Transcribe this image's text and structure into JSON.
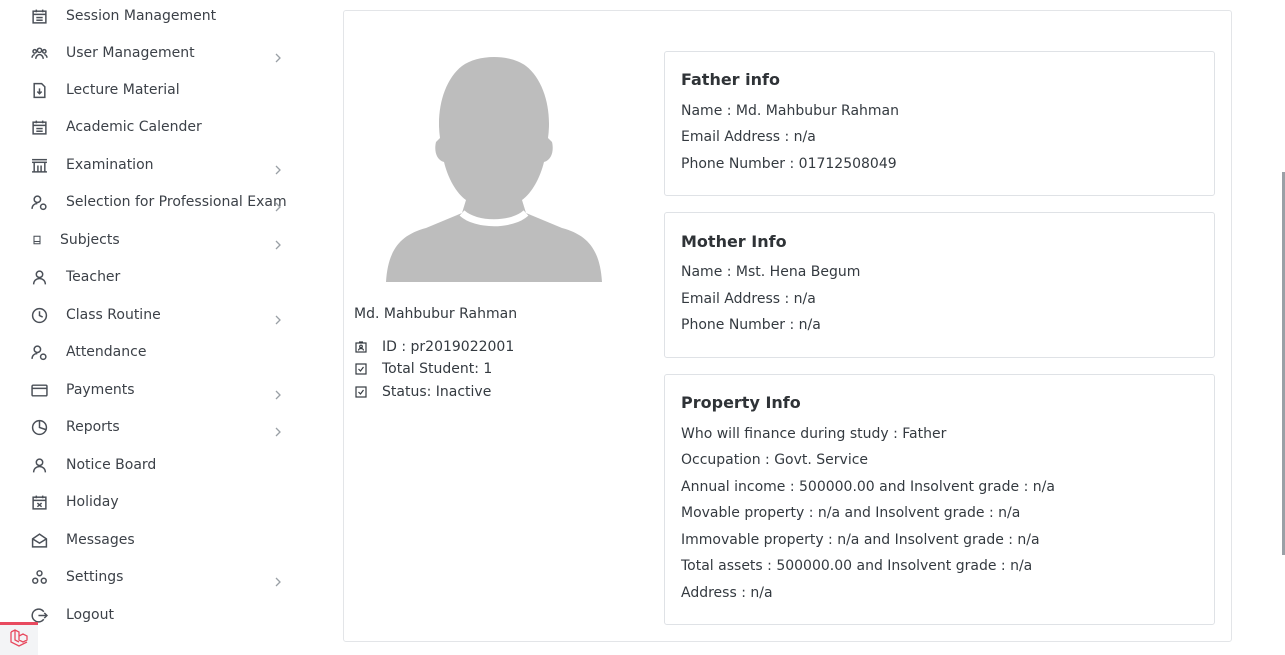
{
  "sidebar": {
    "items": [
      {
        "label": "Session Management",
        "icon": "calendar-icon",
        "chevron": false
      },
      {
        "label": "User Management",
        "icon": "users-icon",
        "chevron": true
      },
      {
        "label": "Lecture Material",
        "icon": "document-icon",
        "chevron": false
      },
      {
        "label": "Academic Calender",
        "icon": "calendar-icon",
        "chevron": false
      },
      {
        "label": "Examination",
        "icon": "building-icon",
        "chevron": true
      },
      {
        "label": "Selection for Professional Exam",
        "icon": "user-check-icon",
        "chevron": true
      },
      {
        "label": "Subjects",
        "icon": "square-icon",
        "chevron": true
      },
      {
        "label": "Teacher",
        "icon": "user-icon",
        "chevron": false
      },
      {
        "label": "Class Routine",
        "icon": "clock-icon",
        "chevron": true
      },
      {
        "label": "Attendance",
        "icon": "user-check-icon",
        "chevron": false
      },
      {
        "label": "Payments",
        "icon": "credit-card-icon",
        "chevron": true
      },
      {
        "label": "Reports",
        "icon": "pie-chart-icon",
        "chevron": true
      },
      {
        "label": "Notice Board",
        "icon": "user-icon",
        "chevron": false
      },
      {
        "label": "Holiday",
        "icon": "calendar-x-icon",
        "chevron": false
      },
      {
        "label": "Messages",
        "icon": "envelope-icon",
        "chevron": false
      },
      {
        "label": "Settings",
        "icon": "cogs-icon",
        "chevron": true
      },
      {
        "label": "Logout",
        "icon": "logout-icon",
        "chevron": false
      }
    ]
  },
  "profile": {
    "name": "Md. Mahbubur Rahman",
    "id_text": "ID : pr2019022001",
    "total_student_text": "Total Student: 1",
    "status_text": "Status: Inactive"
  },
  "father": {
    "title": "Father info",
    "name": "Name : Md. Mahbubur Rahman",
    "email": "Email Address : n/a",
    "phone": "Phone Number : 01712508049"
  },
  "mother": {
    "title": "Mother Info",
    "name": "Name : Mst. Hena Begum",
    "email": "Email Address : n/a",
    "phone": "Phone Number : n/a"
  },
  "property": {
    "title": "Property Info",
    "lines": [
      "Who will finance during study : Father",
      "Occupation : Govt. Service",
      "Annual income : 500000.00 and Insolvent grade : n/a",
      "Movable property : n/a and Insolvent grade : n/a",
      "Immovable property : n/a and Insolvent grade : n/a",
      "Total assets : 500000.00 and Insolvent grade : n/a",
      "Address : n/a"
    ]
  },
  "colors": {
    "laravel_red": "#e84a5f",
    "avatar_gray": "#bdbdbd",
    "border": "#dfe2e6"
  }
}
